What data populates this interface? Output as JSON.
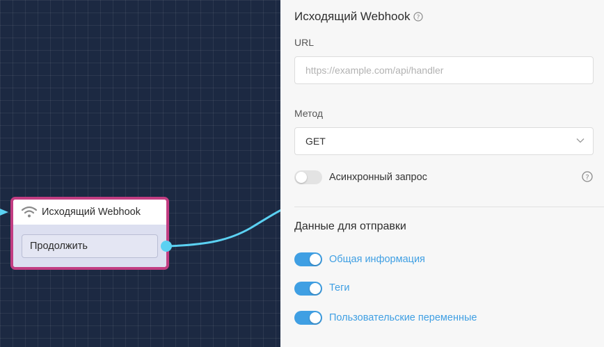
{
  "canvas": {
    "node": {
      "title": "Исходящий Webhook",
      "icon": "wifi-icon",
      "button_label": "Продолжить"
    },
    "colors": {
      "background": "#1c2942",
      "node_border": "#c23d82",
      "connector": "#5bd1f2"
    }
  },
  "panel": {
    "title": "Исходящий Webhook",
    "url": {
      "label": "URL",
      "value": "",
      "placeholder": "https://example.com/api/handler"
    },
    "method": {
      "label": "Метод",
      "selected": "GET"
    },
    "async_request": {
      "label": "Асинхронный запрос",
      "enabled": false
    },
    "data_section": {
      "title": "Данные для отправки",
      "options": [
        {
          "label": "Общая информация",
          "enabled": true
        },
        {
          "label": "Теги",
          "enabled": true
        },
        {
          "label": "Пользовательские переменные",
          "enabled": true
        }
      ]
    },
    "colors": {
      "accent": "#3f9fe3"
    }
  }
}
